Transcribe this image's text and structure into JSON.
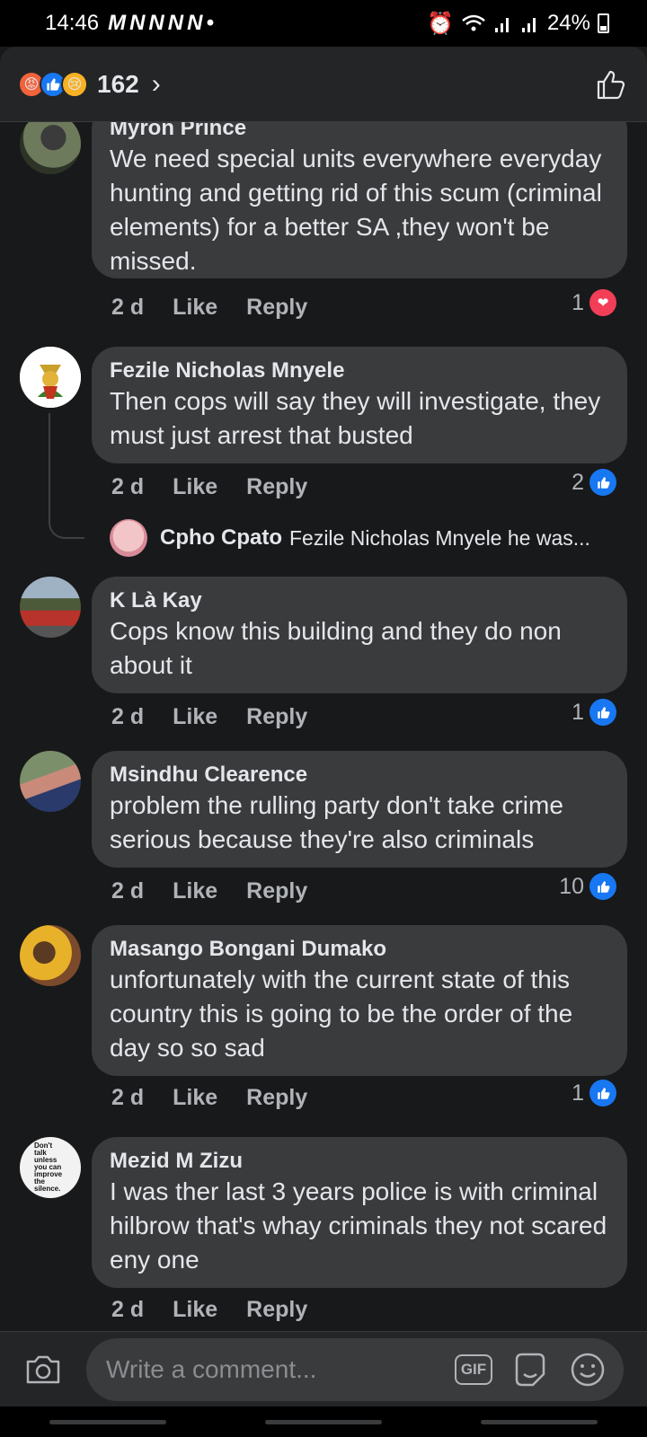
{
  "status_bar": {
    "time": "14:46",
    "notif_icons": [
      "M",
      "N",
      "N",
      "N",
      "N",
      "•"
    ],
    "battery": "24%"
  },
  "reactions": {
    "icons": [
      "angry-icon",
      "like-icon",
      "sad-icon"
    ],
    "count": "162"
  },
  "comments": [
    {
      "author": "Myron Prince",
      "text": "We need special units everywhere everyday hunting and getting rid of this scum (criminal elements) for a better SA ,they won't be missed.",
      "time": "2 d",
      "like_label": "Like",
      "reply_label": "Reply",
      "reaction_count": "1",
      "reaction_type": "love"
    },
    {
      "author": "Fezile Nicholas Mnyele",
      "text": "Then cops will say they will investigate, they must just arrest that busted",
      "time": "2 d",
      "like_label": "Like",
      "reply_label": "Reply",
      "reaction_count": "2",
      "reaction_type": "like",
      "reply_preview": {
        "author": "Cpho Cpato",
        "text": "Fezile Nicholas Mnyele he was..."
      }
    },
    {
      "author": "K Là Kay",
      "text": "Cops know this building and they do non about it",
      "time": "2 d",
      "like_label": "Like",
      "reply_label": "Reply",
      "reaction_count": "1",
      "reaction_type": "like"
    },
    {
      "author": "Msindhu Clearence",
      "text": "problem the rulling party don't take crime serious because they're also criminals",
      "time": "2 d",
      "like_label": "Like",
      "reply_label": "Reply",
      "reaction_count": "10",
      "reaction_type": "like"
    },
    {
      "author": "Masango Bongani Dumako",
      "text": "unfortunately with the current state of this country this is going to be the order of the day so so sad",
      "time": "2 d",
      "like_label": "Like",
      "reply_label": "Reply",
      "reaction_count": "1",
      "reaction_type": "like"
    },
    {
      "author": "Mezid M Zizu",
      "text": "I was ther last 3 years police is with criminal hilbrow that's whay criminals they not scared eny one",
      "time": "2 d",
      "like_label": "Like",
      "reply_label": "Reply",
      "avatar_text": "Don't talk unless you can improve the silence."
    }
  ],
  "composer": {
    "placeholder": "Write a comment...",
    "gif_label": "GIF"
  },
  "colors": {
    "background": "#18191a",
    "bubble": "#3a3b3c",
    "like_blue": "#1877f2",
    "love_red": "#f33e58"
  }
}
